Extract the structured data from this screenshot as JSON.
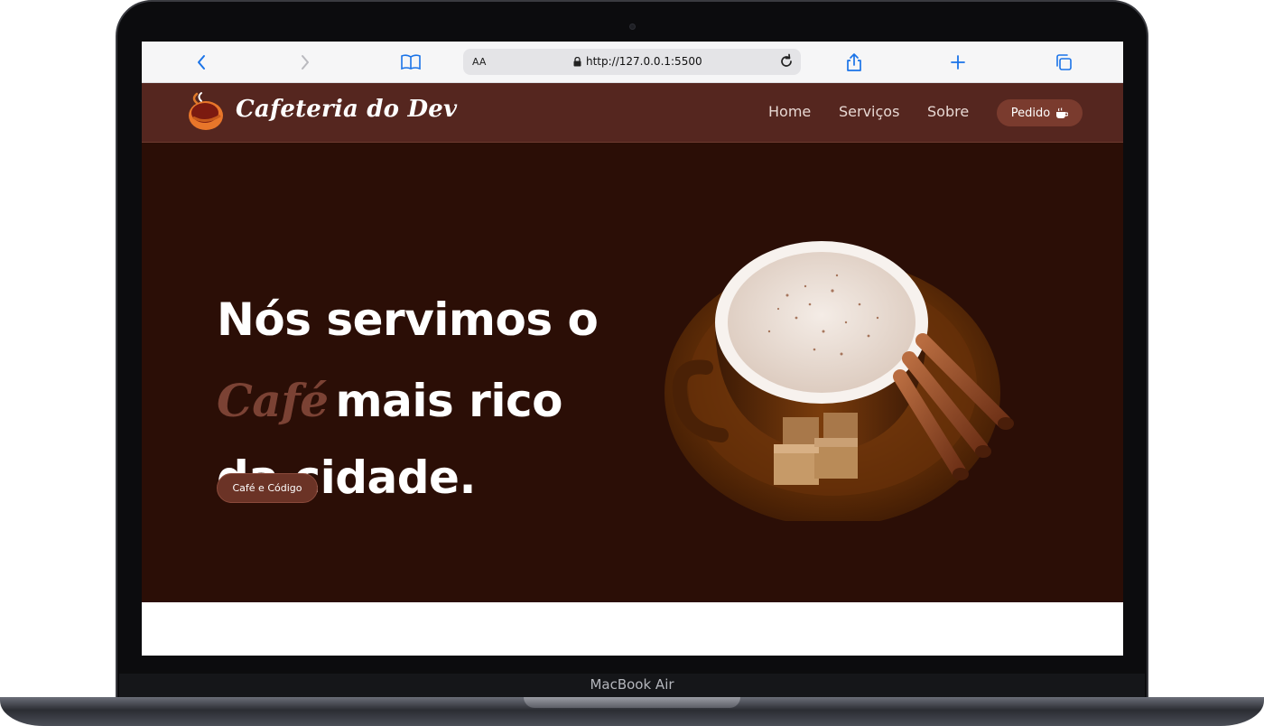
{
  "device": {
    "label": "MacBook Air"
  },
  "browser": {
    "reader_label": "AA",
    "url": "http://127.0.0.1:5500"
  },
  "site": {
    "brand": "Cafeteria do Dev",
    "nav": [
      {
        "label": "Home"
      },
      {
        "label": "Serviços"
      },
      {
        "label": "Sobre"
      }
    ],
    "order_button": "Pedido",
    "hero": {
      "line1": "Nós servimos o",
      "highlight": "Café",
      "line2_rest": "mais rico",
      "line3": "da cidade.",
      "cta": "Café e Código"
    }
  },
  "colors": {
    "navbar": "#55261f",
    "hero_bg": "#2b0e06",
    "accent": "#7b4234",
    "button": "#6b3326"
  }
}
